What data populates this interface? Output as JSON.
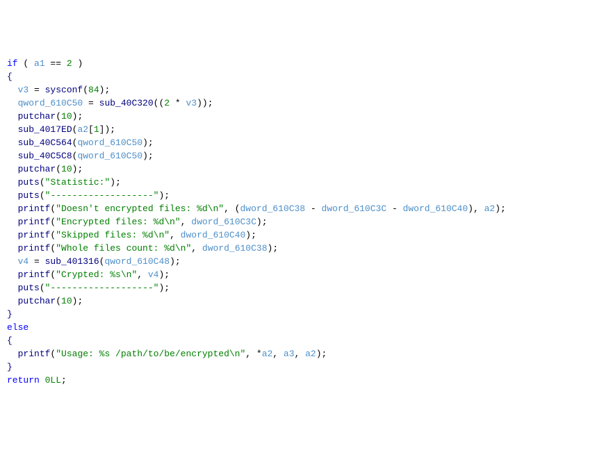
{
  "code": {
    "line1_if": "if",
    "line1_open": " ( ",
    "line1_a1": "a1",
    "line1_eq": " == ",
    "line1_two": "2",
    "line1_close": " )",
    "line2_brace": "{",
    "line3_indent": "  ",
    "line3_v3": "v3",
    "line3_assign": " = ",
    "line3_sysconf": "sysconf",
    "line3_open": "(",
    "line3_arg": "84",
    "line3_close": ");",
    "line4_indent": "  ",
    "line4_qword": "qword_610C50",
    "line4_assign": " = ",
    "line4_fn": "sub_40C320",
    "line4_open": "((",
    "line4_two": "2",
    "line4_mul": " * ",
    "line4_v3": "v3",
    "line4_close": "));",
    "line5_indent": "  ",
    "line5_fn": "putchar",
    "line5_open": "(",
    "line5_arg": "10",
    "line5_close": ");",
    "line6_indent": "  ",
    "line6_fn": "sub_4017ED",
    "line6_open": "(",
    "line6_a2": "a2",
    "line6_br_open": "[",
    "line6_idx": "1",
    "line6_br_close": "]",
    "line6_close": ");",
    "line7_indent": "  ",
    "line7_fn": "sub_40C564",
    "line7_open": "(",
    "line7_arg": "qword_610C50",
    "line7_close": ");",
    "line8_indent": "  ",
    "line8_fn": "sub_40C5C8",
    "line8_open": "(",
    "line8_arg": "qword_610C50",
    "line8_close": ");",
    "line9_indent": "  ",
    "line9_fn": "putchar",
    "line9_open": "(",
    "line9_arg": "10",
    "line9_close": ");",
    "line10_indent": "  ",
    "line10_fn": "puts",
    "line10_open": "(",
    "line10_str": "\"Statistic:\"",
    "line10_close": ");",
    "line11_indent": "  ",
    "line11_fn": "puts",
    "line11_open": "(",
    "line11_str": "\"-------------------\"",
    "line11_close": ");",
    "line12_indent": "  ",
    "line12_fn": "printf",
    "line12_open": "(",
    "line12_str": "\"Doesn't encrypted files: %d\\n\"",
    "line12_comma1": ", (",
    "line12_d1": "dword_610C38",
    "line12_minus1": " - ",
    "line12_d2": "dword_610C3C",
    "line12_minus2": " - ",
    "line12_d3": "dword_610C40",
    "line12_close1": "), ",
    "line12_a2": "a2",
    "line12_close2": ");",
    "line13_indent": "  ",
    "line13_fn": "printf",
    "line13_open": "(",
    "line13_str": "\"Encrypted files: %d\\n\"",
    "line13_comma": ", ",
    "line13_arg": "dword_610C3C",
    "line13_close": ");",
    "line14_indent": "  ",
    "line14_fn": "printf",
    "line14_open": "(",
    "line14_str": "\"Skipped files: %d\\n\"",
    "line14_comma": ", ",
    "line14_arg": "dword_610C40",
    "line14_close": ");",
    "line15_indent": "  ",
    "line15_fn": "printf",
    "line15_open": "(",
    "line15_str": "\"Whole files count: %d\\n\"",
    "line15_comma": ", ",
    "line15_arg": "dword_610C38",
    "line15_close": ");",
    "line16_indent": "  ",
    "line16_v4": "v4",
    "line16_assign": " = ",
    "line16_fn": "sub_401316",
    "line16_open": "(",
    "line16_arg": "qword_610C48",
    "line16_close": ");",
    "line17_indent": "  ",
    "line17_fn": "printf",
    "line17_open": "(",
    "line17_str": "\"Crypted: %s\\n\"",
    "line17_comma": ", ",
    "line17_arg": "v4",
    "line17_close": ");",
    "line18_indent": "  ",
    "line18_fn": "puts",
    "line18_open": "(",
    "line18_str": "\"-------------------\"",
    "line18_close": ");",
    "line19_indent": "  ",
    "line19_fn": "putchar",
    "line19_open": "(",
    "line19_arg": "10",
    "line19_close": ");",
    "line20_brace": "}",
    "line21_else": "else",
    "line22_brace": "{",
    "line23_indent": "  ",
    "line23_fn": "printf",
    "line23_open": "(",
    "line23_str": "\"Usage: %s /path/to/be/encrypted\\n\"",
    "line23_comma1": ", *",
    "line23_a2a": "a2",
    "line23_comma2": ", ",
    "line23_a3": "a3",
    "line23_comma3": ", ",
    "line23_a2b": "a2",
    "line23_close": ");",
    "line24_brace": "}",
    "line25_return": "return",
    "line25_sp": " ",
    "line25_zero": "0LL",
    "line25_semi": ";"
  }
}
